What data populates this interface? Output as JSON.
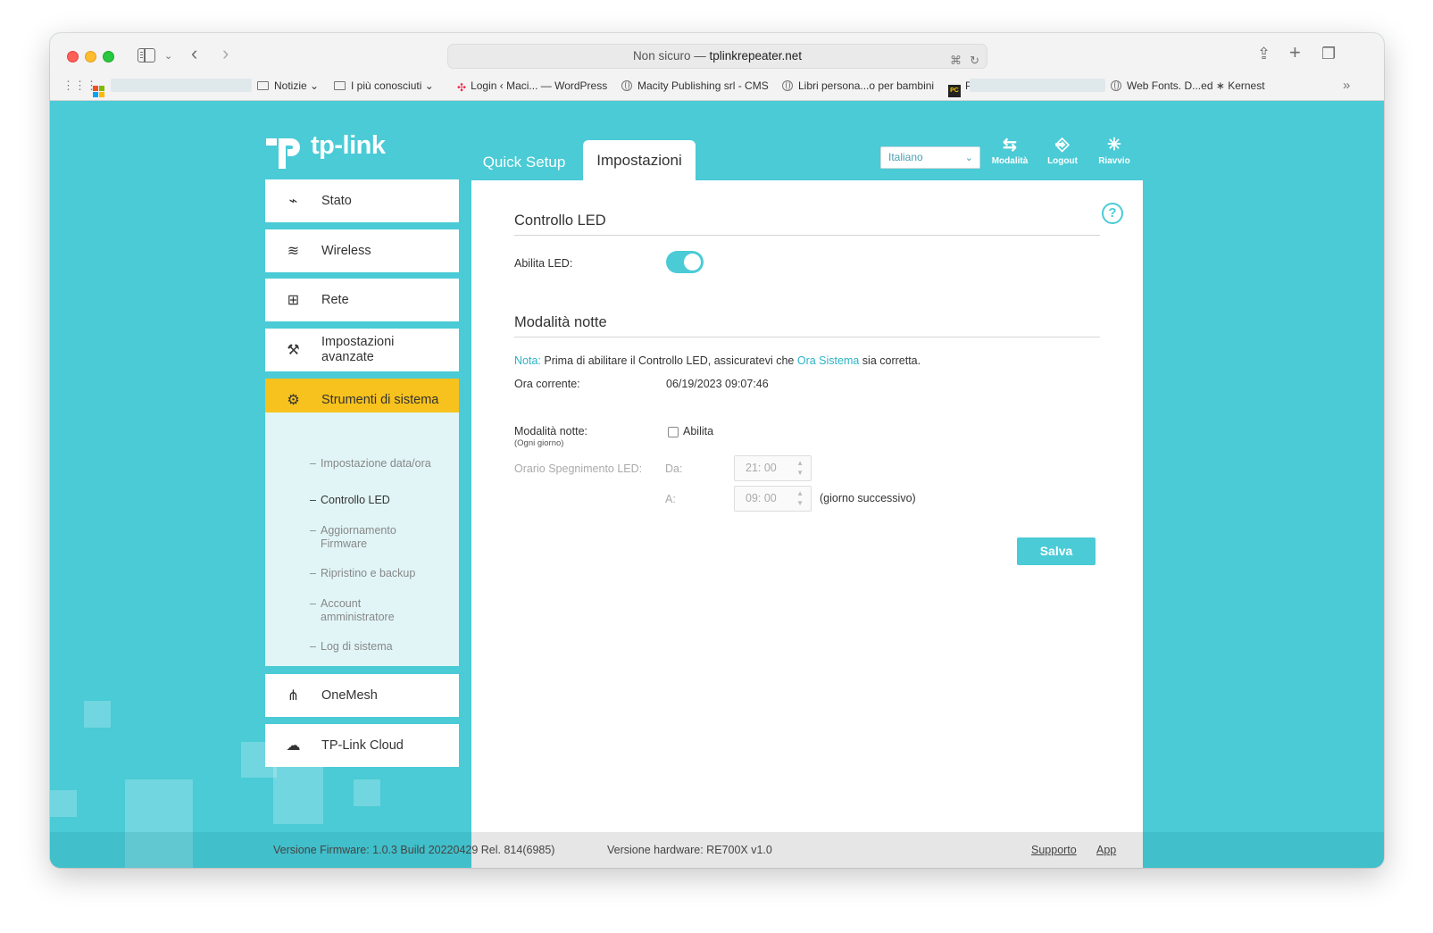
{
  "browser": {
    "address_prefix": "Non sicuro — ",
    "address_host": "tplinkrepeater.net",
    "bookmarks": [
      {
        "label": "Notizie ⌄",
        "icon": "folder-icon"
      },
      {
        "label": "I più conosciuti ⌄",
        "icon": "folder-icon"
      },
      {
        "label": "Login ‹ Maci... — WordPress",
        "icon": "wordpress-icon"
      },
      {
        "label": "Macity Publishing srl - CMS",
        "icon": "globe-icon"
      },
      {
        "label": "Libri persona...o per bambini",
        "icon": "globe-icon"
      },
      {
        "label": "P",
        "icon": "pc-icon"
      },
      {
        "label": "Web Fonts. D...ed ∗ Kernest",
        "icon": "globe-icon"
      }
    ]
  },
  "brand": {
    "name": "tp-link"
  },
  "tabs": {
    "quick_setup": "Quick Setup",
    "settings": "Impostazioni"
  },
  "language": {
    "selected": "Italiano"
  },
  "top_actions": {
    "mode": "Modalità",
    "logout": "Logout",
    "reboot": "Riavvio"
  },
  "sidebar": {
    "items": [
      {
        "label": "Stato"
      },
      {
        "label": "Wireless"
      },
      {
        "label": "Rete"
      },
      {
        "label": "Impostazioni avanzate"
      },
      {
        "label": "Strumenti di sistema"
      },
      {
        "label": "OneMesh"
      },
      {
        "label": "TP-Link Cloud"
      }
    ],
    "subitems": [
      {
        "label": "Impostazione data/ora"
      },
      {
        "label": "Controllo LED"
      },
      {
        "label": "Aggiornamento Firmware"
      },
      {
        "label": "Ripristino e backup"
      },
      {
        "label": "Account amministratore"
      },
      {
        "label": "Log di sistema"
      }
    ]
  },
  "led": {
    "title": "Controllo LED",
    "enable_label": "Abilita LED:",
    "enabled": true
  },
  "night": {
    "title": "Modalità notte",
    "note_label": "Nota:",
    "note_text_1": "Prima di abilitare il Controllo LED, assicuratevi che",
    "note_link": "Ora Sistema",
    "note_text_2": "sia corretta.",
    "current_time_label": "Ora corrente:",
    "current_time_value": "06/19/2023 09:07:46",
    "mode_label": "Modalità notte:",
    "mode_sublabel": "(Ogni giorno)",
    "enable_checkbox_label": "Abilita",
    "off_schedule_label": "Orario Spegnimento LED:",
    "from_label": "Da:",
    "from_value": "21: 00",
    "to_label": "A:",
    "to_value": "09: 00",
    "next_day_label": "(giorno successivo)"
  },
  "actions": {
    "save": "Salva"
  },
  "footer": {
    "firmware": "Versione Firmware: 1.0.3 Build 20220429 Rel. 814(6985)",
    "hardware": "Versione hardware: RE700X v1.0",
    "support": "Supporto",
    "app": "App"
  },
  "colors": {
    "accent": "#4acbd6",
    "active_nav": "#f7c21d"
  }
}
